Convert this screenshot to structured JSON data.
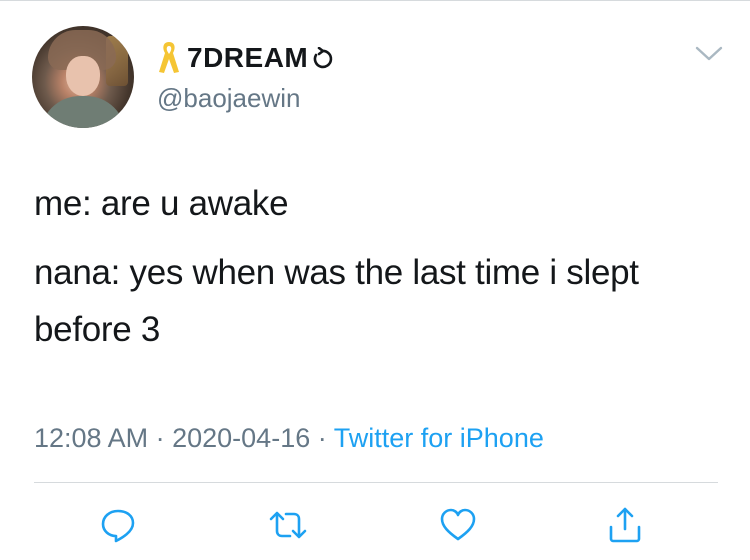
{
  "tweet": {
    "display_name": "7DREAM",
    "handle": "@baojaewin",
    "lines": [
      "me: are u awake",
      "nana: yes when was the last time i slept before 3"
    ],
    "time": "12:08 AM",
    "separator": "·",
    "date": "2020-04-16",
    "source": "Twitter for iPhone"
  },
  "icons": {
    "name_prefix": "ribbon-icon",
    "name_suffix": "refresh-icon",
    "menu": "chevron-down-icon",
    "actions": [
      "reply-icon",
      "retweet-icon",
      "like-icon",
      "share-icon"
    ]
  },
  "colors": {
    "text": "#14171a",
    "secondary": "#657786",
    "link": "#1da1f2",
    "ribbon": "#f5c534",
    "icon": "#1da1f2"
  }
}
